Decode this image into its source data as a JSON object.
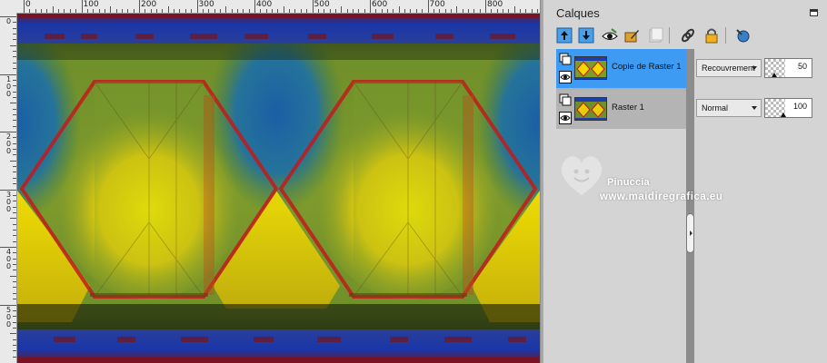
{
  "canvas": {
    "ruler_top_labels": [
      "0",
      "100",
      "200",
      "300",
      "400",
      "500",
      "600",
      "700",
      "800"
    ],
    "ruler_left_labels": [
      "0",
      "1 0 0",
      "2 0 0",
      "3 0 0",
      "4 0 0",
      "5 0 0"
    ],
    "colors": {
      "band_dark_red": "#7a1323",
      "band_blue": "#1c3fb0",
      "green": "#5f8f2c",
      "yellow": "#f2d900",
      "teal": "#1d6fa0",
      "red_stroke": "#c11b1b"
    }
  },
  "layers_panel": {
    "title": "Calques",
    "maximize_icon": "panel-maximize-icon",
    "toolbar": [
      {
        "name": "move-layer-up-icon"
      },
      {
        "name": "move-layer-down-icon"
      },
      {
        "name": "toggle-visibility-icon"
      },
      {
        "name": "edit-layer-icon"
      },
      {
        "name": "delete-layer-icon"
      },
      {
        "name": "link-layer-icon"
      },
      {
        "name": "lock-layer-icon"
      },
      {
        "name": "layer-properties-icon"
      }
    ],
    "layers": [
      {
        "name": "Copie de Raster 1",
        "blend_mode": "Recouvrement",
        "opacity": "50",
        "opacity_fraction": 0.5,
        "selected": true
      },
      {
        "name": "Raster 1",
        "blend_mode": "Normal",
        "opacity": "100",
        "opacity_fraction": 1.0,
        "selected": false
      }
    ],
    "selected_color": "#3d9bf3"
  },
  "watermark": {
    "name": "Pinuccia",
    "url": "www.maidiregrafica.eu"
  }
}
